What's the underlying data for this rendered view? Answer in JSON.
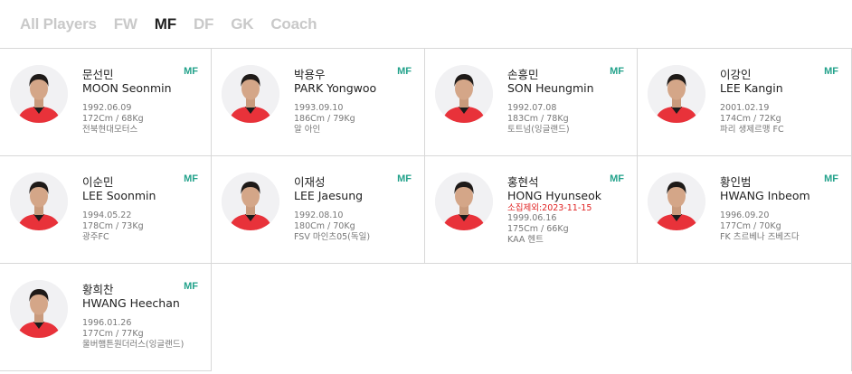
{
  "tabs": [
    {
      "label": "All Players",
      "active": false
    },
    {
      "label": "FW",
      "active": false
    },
    {
      "label": "MF",
      "active": true
    },
    {
      "label": "DF",
      "active": false
    },
    {
      "label": "GK",
      "active": false
    },
    {
      "label": "Coach",
      "active": false
    }
  ],
  "colors": {
    "accent": "#23a28b",
    "excluded": "#e02020",
    "jersey": "#e8323a"
  },
  "players": [
    {
      "name_ko": "문선민",
      "name_en": "MOON Seonmin",
      "position": "MF",
      "excluded": "",
      "birth": "1992.06.09",
      "body": "172Cm / 68Kg",
      "club": "전북현대모터스"
    },
    {
      "name_ko": "박용우",
      "name_en": "PARK Yongwoo",
      "position": "MF",
      "excluded": "",
      "birth": "1993.09.10",
      "body": "186Cm / 79Kg",
      "club": "알 아인"
    },
    {
      "name_ko": "손흥민",
      "name_en": "SON Heungmin",
      "position": "MF",
      "excluded": "",
      "birth": "1992.07.08",
      "body": "183Cm / 78Kg",
      "club": "토트넘(잉글랜드)"
    },
    {
      "name_ko": "이강인",
      "name_en": "LEE Kangin",
      "position": "MF",
      "excluded": "",
      "birth": "2001.02.19",
      "body": "174Cm / 72Kg",
      "club": "파리 생제르맹 FC"
    },
    {
      "name_ko": "이순민",
      "name_en": "LEE Soonmin",
      "position": "MF",
      "excluded": "",
      "birth": "1994.05.22",
      "body": "178Cm / 73Kg",
      "club": "광주FC"
    },
    {
      "name_ko": "이재성",
      "name_en": "LEE Jaesung",
      "position": "MF",
      "excluded": "",
      "birth": "1992.08.10",
      "body": "180Cm / 70Kg",
      "club": "FSV 마인츠05(독일)"
    },
    {
      "name_ko": "홍현석",
      "name_en": "HONG Hyunseok",
      "position": "MF",
      "excluded": "소집제외:2023-11-15",
      "birth": "1999.06.16",
      "body": "175Cm / 66Kg",
      "club": "KAA 헨트"
    },
    {
      "name_ko": "황인범",
      "name_en": "HWANG Inbeom",
      "position": "MF",
      "excluded": "",
      "birth": "1996.09.20",
      "body": "177Cm / 70Kg",
      "club": "FK 츠르베나 즈베즈다"
    },
    {
      "name_ko": "황희찬",
      "name_en": "HWANG Heechan",
      "position": "MF",
      "excluded": "",
      "birth": "1996.01.26",
      "body": "177Cm / 77Kg",
      "club": "울버햄튼원더러스(잉글랜드)"
    }
  ]
}
